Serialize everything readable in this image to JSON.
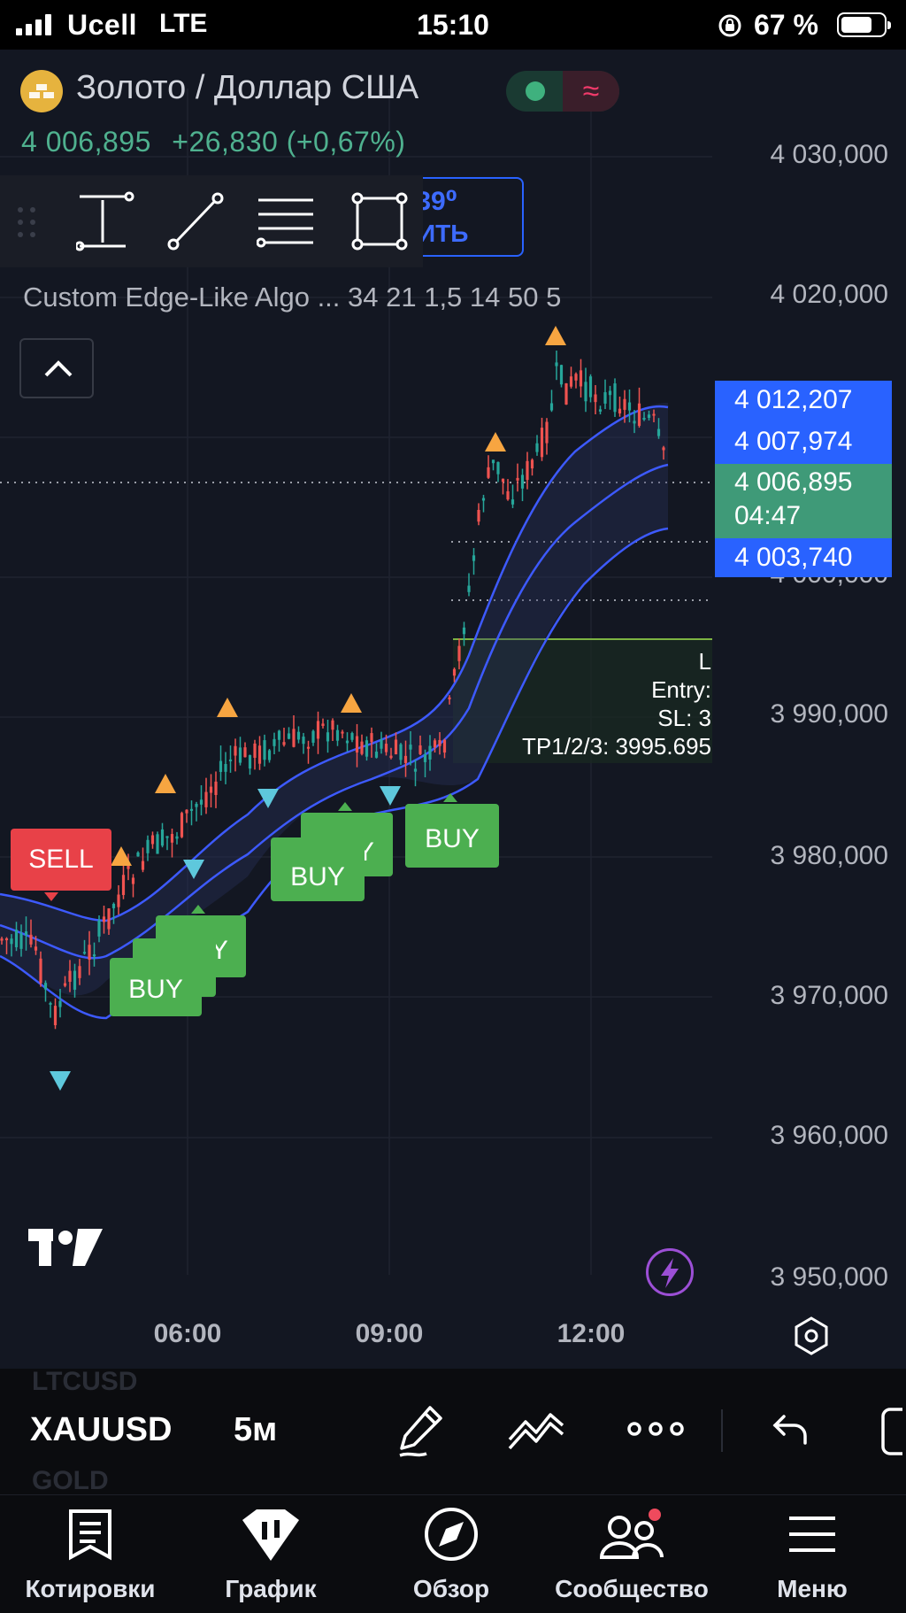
{
  "status_bar": {
    "carrier": "Ucell",
    "network": "LTE",
    "time": "15:10",
    "battery_percent": "67 %"
  },
  "header": {
    "instrument_title": "Золото / Доллар США",
    "last_price": "4 006,895",
    "change": "+26,830 (+0,67%)",
    "hidden_button_price": ",39⁰",
    "hidden_button_text": "ИТЬ"
  },
  "indicator": {
    "label": "Custom Edge-Like Algo ...  34  21  1,5  14  50  5"
  },
  "price_axis": {
    "labels": [
      "4 030,000",
      "4 020,000",
      "4 000,000",
      "3 990,000",
      "3 980,000",
      "3 970,000",
      "3 960,000",
      "3 950,000"
    ],
    "tags": [
      {
        "value": "4 012,207",
        "color": "#2962ff"
      },
      {
        "value": "4 007,974",
        "color": "#2962ff"
      },
      {
        "value": "4 006,895",
        "sub": "04:47",
        "color": "#3f9a78"
      },
      {
        "value": "4 003,740",
        "color": "#2962ff"
      }
    ]
  },
  "time_axis": {
    "labels": [
      "06:00",
      "09:00",
      "12:00"
    ]
  },
  "signals": {
    "sell": "SELL",
    "buy": "BUY"
  },
  "trade_info": {
    "line1": "L",
    "entry": "Entry:",
    "sl": "SL: 3",
    "tp": "TP1/2/3: 3995.695"
  },
  "colors": {
    "up": "#26a69a",
    "down": "#ef5350",
    "band": "#3d5afe",
    "sell_box": "#e84148",
    "buy_box": "#4caf50",
    "arrow_up": "#f7a541",
    "arrow_down": "#5ec8dc"
  },
  "symbol_bar": {
    "symbol": "XAUUSD",
    "prev_symbol": "LTCUSD",
    "next_symbol": "GOLD",
    "interval": "5м"
  },
  "tabs": [
    {
      "label": "Котировки",
      "icon": "quotes-icon"
    },
    {
      "label": "График",
      "icon": "chart-icon"
    },
    {
      "label": "Обзор",
      "icon": "compass-icon"
    },
    {
      "label": "Сообщество",
      "icon": "community-icon"
    },
    {
      "label": "Меню",
      "icon": "menu-icon"
    }
  ]
}
